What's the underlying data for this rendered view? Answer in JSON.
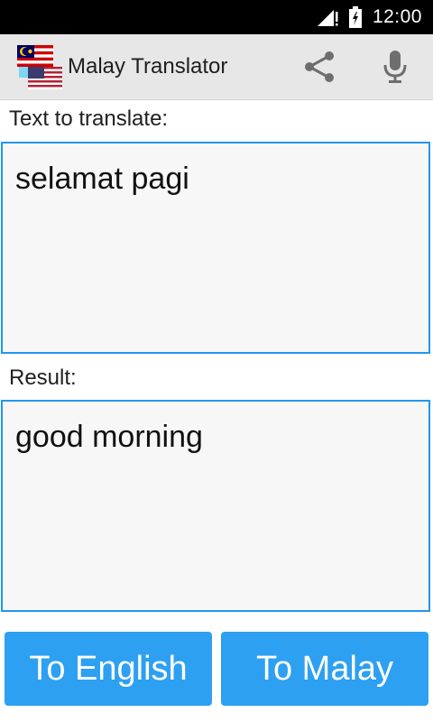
{
  "status_bar": {
    "time": "12:00"
  },
  "app_bar": {
    "title": "Malay Translator",
    "icons": [
      "malaysia-flag-icon",
      "us-flag-icon",
      "share-icon",
      "microphone-icon"
    ]
  },
  "source": {
    "label": "Text to translate:",
    "text": "selamat pagi"
  },
  "result": {
    "label": "Result:",
    "text": "good morning"
  },
  "buttons": {
    "to_english": "To English",
    "to_malay": "To Malay"
  },
  "colors": {
    "accent": "#2196f3",
    "button": "#2ea0f2",
    "app_bar": "#e7e7e7"
  }
}
